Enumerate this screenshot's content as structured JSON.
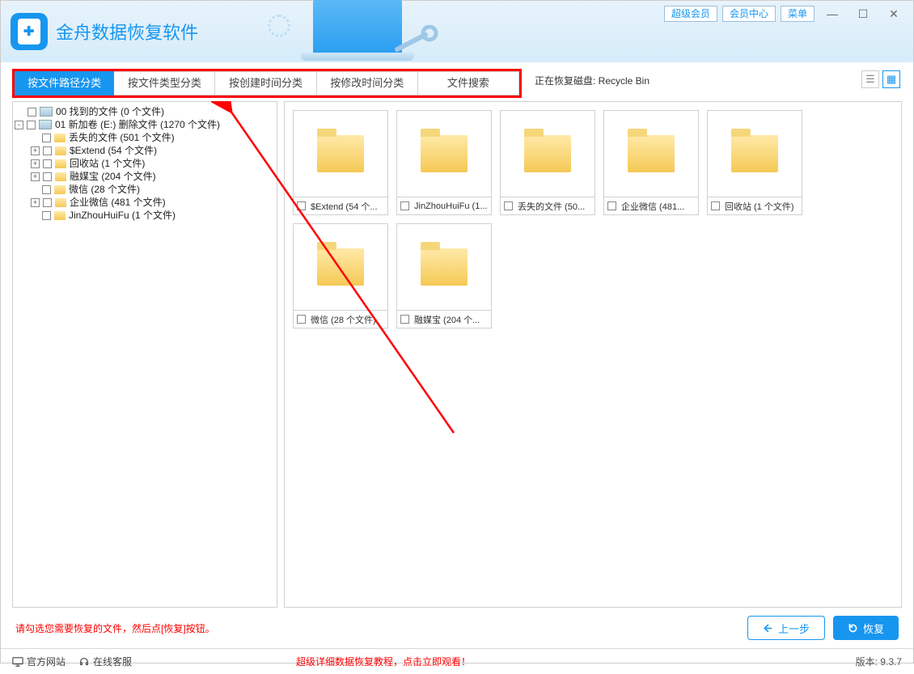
{
  "app": {
    "title": "金舟数据恢复软件"
  },
  "header_buttons": {
    "vip": "超级会员",
    "member": "会员中心",
    "menu": "菜单"
  },
  "tabs": {
    "t1": "按文件路径分类",
    "t2": "按文件类型分类",
    "t3": "按创建时间分类",
    "t4": "按修改时间分类",
    "t5": "文件搜索"
  },
  "status": "正在恢复磁盘: Recycle Bin",
  "tree": {
    "n0": "00 找到的文件   (0 个文件)",
    "n1": "01 新加卷 (E:) 删除文件  (1270 个文件)",
    "n1_0": "丢失的文件     (501 个文件)",
    "n1_1": "$Extend     (54 个文件)",
    "n1_2": "回收站     (1 个文件)",
    "n1_3": "融媒宝     (204 个文件)",
    "n1_4": "微信     (28 个文件)",
    "n1_5": "企业微信     (481 个文件)",
    "n1_6": "JinZhouHuiFu     (1 个文件)"
  },
  "cards": {
    "c0": "$Extend  (54 个...",
    "c1": "JinZhouHuiFu  (1...",
    "c2": "丢失的文件  (50...",
    "c3": "企业微信  (481...",
    "c4": "回收站  (1 个文件)",
    "c5": "微信  (28 个文件)",
    "c6": "融媒宝  (204 个..."
  },
  "hint": "请勾选您需要恢复的文件，然后点[恢复]按钮。",
  "buttons": {
    "prev": "上一步",
    "recover": "恢复"
  },
  "footer": {
    "site": "官方网站",
    "support": "在线客服",
    "tutorial": "超级详细数据恢复教程，点击立即观看！",
    "version": "版本: 9.3.7"
  }
}
